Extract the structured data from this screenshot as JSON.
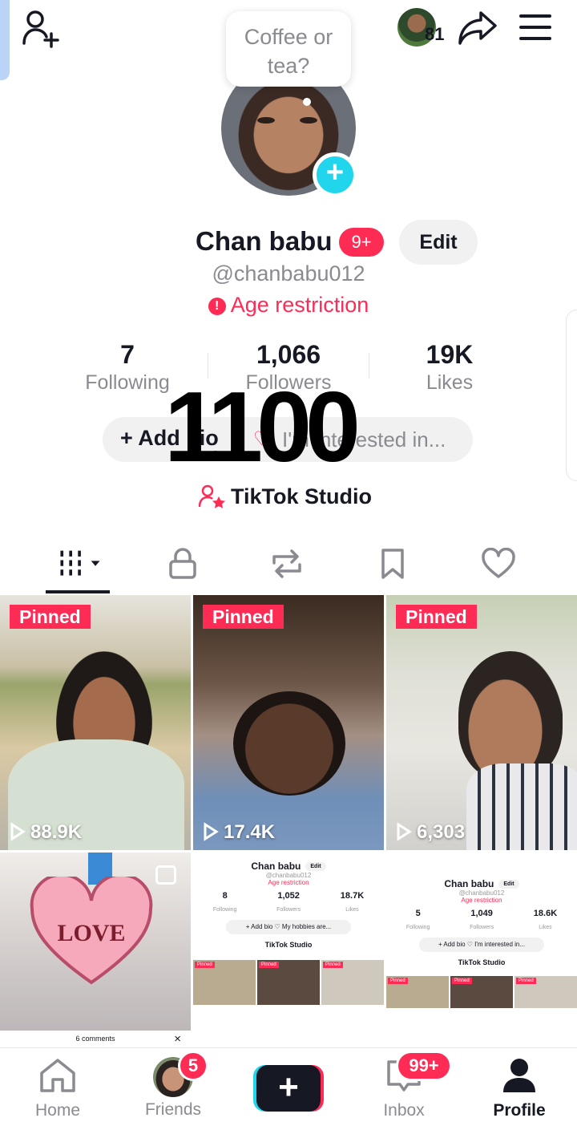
{
  "header": {
    "mini_avatar_count": "81",
    "bubble_text_line1": "Coffee or",
    "bubble_text_line2": "tea?"
  },
  "profile": {
    "name": "Chan babu",
    "badge": "9+",
    "edit_label": "Edit",
    "handle": "@chanbabu012",
    "age_restriction": "Age restriction",
    "age_icon": "!",
    "stats": [
      {
        "value": "7",
        "label": "Following"
      },
      {
        "value": "1,066",
        "label": "Followers"
      },
      {
        "value": "19K",
        "label": "Likes"
      }
    ],
    "overlay_number": "1100",
    "add_bio": "+ Add bio",
    "interest_placeholder": "I'm interested in...",
    "studio_label": "TikTok Studio"
  },
  "tabs": [
    "videos-grid",
    "private",
    "reposts",
    "favorites",
    "liked"
  ],
  "videos": [
    {
      "pinned": "Pinned",
      "views": "88.9K"
    },
    {
      "pinned": "Pinned",
      "views": "17.4K"
    },
    {
      "pinned": "Pinned",
      "views": "6,303"
    }
  ],
  "row2": {
    "love_text": "LOVE",
    "comments": "6 comments",
    "close": "×",
    "mini1": {
      "name": "Chan babu",
      "handle": "@chanbabu012",
      "age": "Age restriction",
      "edit": "Edit",
      "stats": [
        {
          "v": "8",
          "l": "Following"
        },
        {
          "v": "1,052",
          "l": "Followers"
        },
        {
          "v": "18.7K",
          "l": "Likes"
        }
      ],
      "bio": "+ Add bio   ♡ My hobbies are...",
      "studio": "TikTok Studio",
      "pinned": "Pinned"
    },
    "mini2": {
      "name": "Chan babu",
      "handle": "@chanbabu012",
      "age": "Age restriction",
      "edit": "Edit",
      "stats": [
        {
          "v": "5",
          "l": "Following"
        },
        {
          "v": "1,049",
          "l": "Followers"
        },
        {
          "v": "18.6K",
          "l": "Likes"
        }
      ],
      "bio": "+ Add bio   ♡ I'm interested in...",
      "studio": "TikTok Studio",
      "pinned": "Pinned"
    }
  },
  "nav": {
    "home": "Home",
    "friends": "Friends",
    "friends_badge": "5",
    "create": "+",
    "inbox": "Inbox",
    "inbox_badge": "99+",
    "profile": "Profile"
  },
  "colors": {
    "accent": "#fe2c55",
    "cyan": "#20d5ec",
    "text": "#161823",
    "muted": "#8a8b91"
  }
}
